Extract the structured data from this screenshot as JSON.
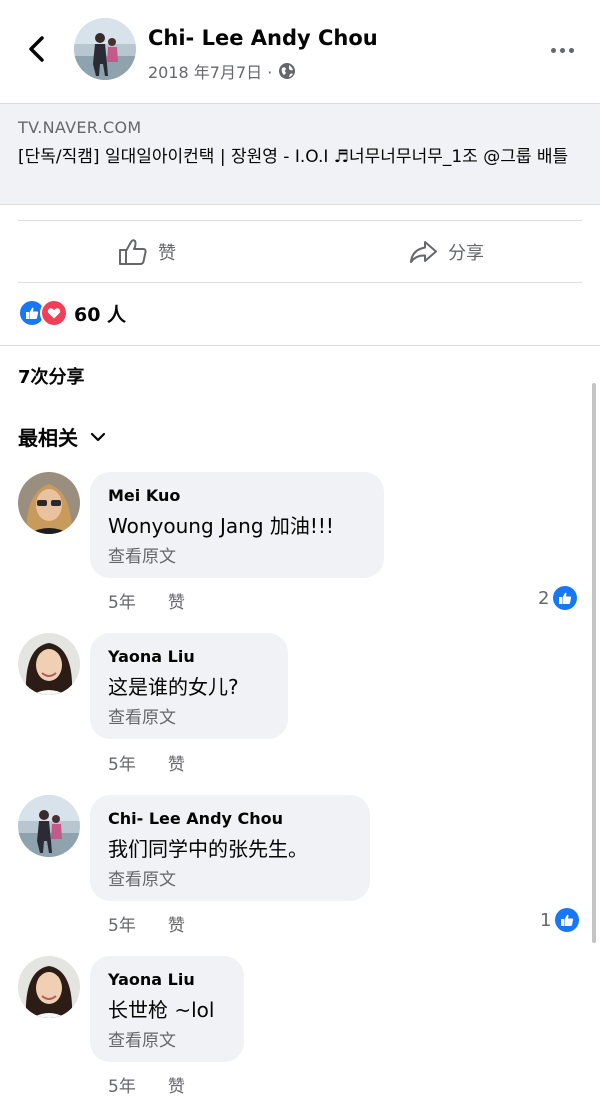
{
  "post": {
    "author": "Chi- Lee Andy Chou",
    "date": "2018 年7月7日 ·"
  },
  "link_preview": {
    "domain": "TV.NAVER.COM",
    "title": "[단독/직캠] 일대일아이컨택 | 장원영 - I.O.I ♬너무너무너무_1조 @그룹 배틀"
  },
  "actions": {
    "like": "赞",
    "share": "分享"
  },
  "reactions": {
    "count": "60 人"
  },
  "shares_text": "7次分享",
  "sort_label": "最相关",
  "colors": {
    "like_blue": "#1877f2",
    "love_red": "#f33e58",
    "bubble_bg": "#f0f2f5",
    "secondary_text": "#65676b"
  },
  "comments": [
    {
      "author": "Mei Kuo",
      "text": "Wonyoung Jang 加油!!!",
      "translate": "查看原文",
      "time": "5年",
      "like": "赞",
      "reaction_count": "2"
    },
    {
      "author": "Yaona Liu",
      "text": "这是谁的女儿?",
      "translate": "查看原文",
      "time": "5年",
      "like": "赞",
      "reaction_count": ""
    },
    {
      "author": "Chi- Lee Andy Chou",
      "text": "我们同学中的张先生。",
      "translate": "查看原文",
      "time": "5年",
      "like": "赞",
      "reaction_count": "1"
    },
    {
      "author": "Yaona Liu",
      "text": "长世枪 ~lol",
      "translate": "查看原文",
      "time": "5年",
      "like": "赞",
      "reaction_count": ""
    }
  ]
}
